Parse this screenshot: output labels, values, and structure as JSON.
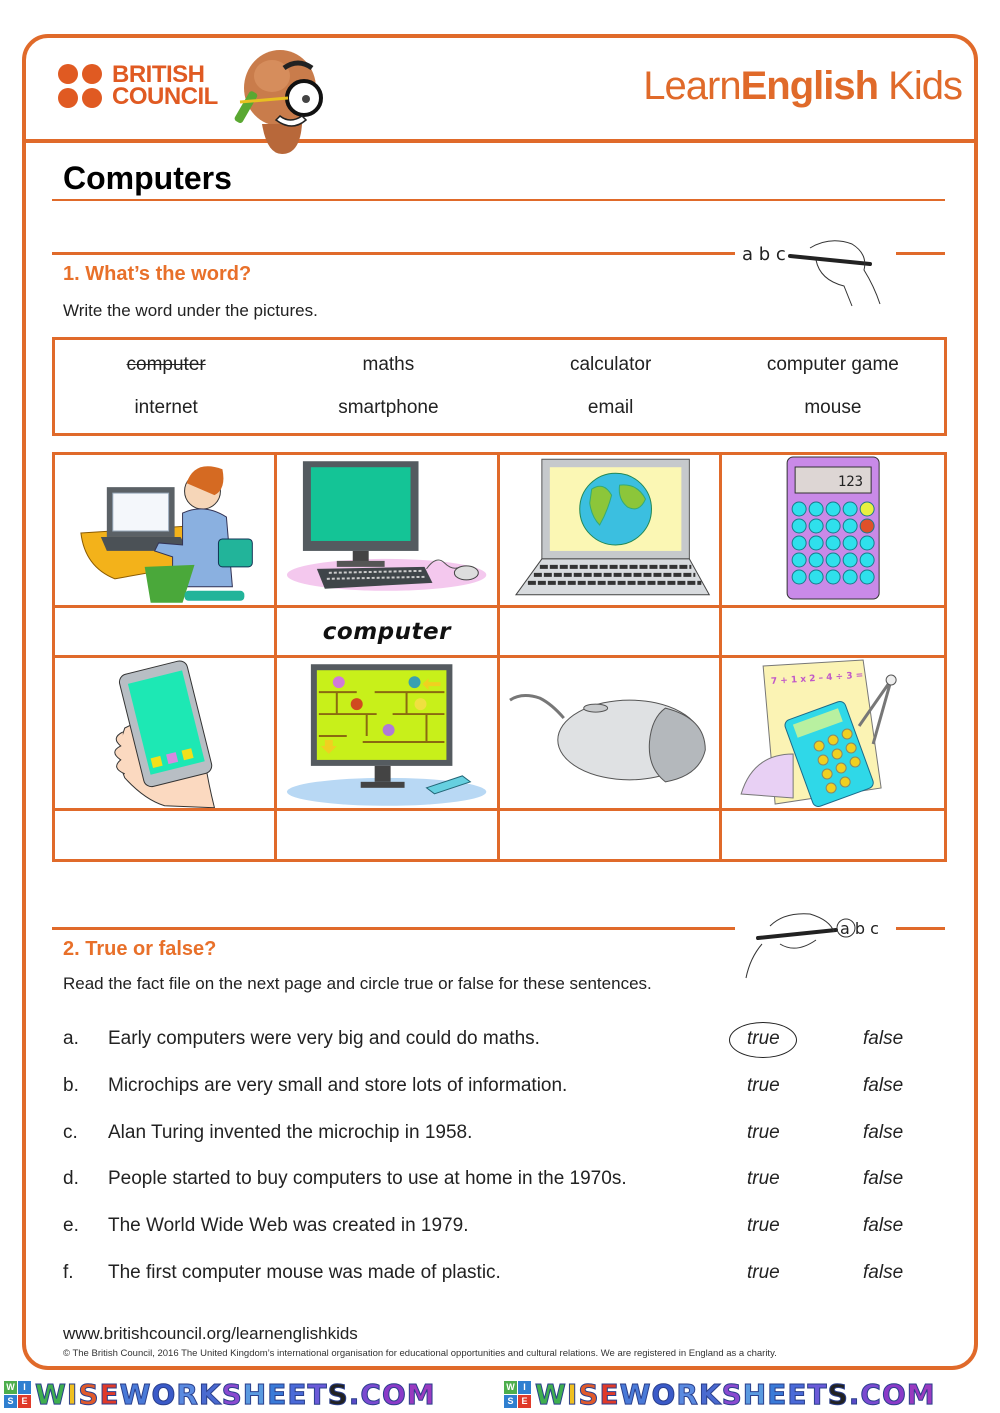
{
  "header": {
    "org_logo_line1": "BRITISH",
    "org_logo_line2": "COUNCIL",
    "brand_light": "Learn",
    "brand_bold": "English",
    "brand_tail": " Kids"
  },
  "page_title": "Computers",
  "section1": {
    "title": "1. What’s the word?",
    "instruction": "Write the word under the pictures.",
    "hand_icon_letters": "a b c",
    "word_bank": [
      {
        "word": "computer",
        "struck": true
      },
      {
        "word": "maths",
        "struck": false
      },
      {
        "word": "calculator",
        "struck": false
      },
      {
        "word": "computer game",
        "struck": false
      },
      {
        "word": "internet",
        "struck": false
      },
      {
        "word": "smartphone",
        "struck": false
      },
      {
        "word": "email",
        "struck": false
      },
      {
        "word": "mouse",
        "struck": false
      }
    ],
    "pictures_row1": [
      {
        "icon": "person-typing-on-laptop-icon",
        "answer": ""
      },
      {
        "icon": "desktop-computer-icon",
        "answer": "computer"
      },
      {
        "icon": "laptop-with-globe-icon",
        "answer": ""
      },
      {
        "icon": "calculator-icon",
        "answer": ""
      }
    ],
    "pictures_row2": [
      {
        "icon": "smartphone-in-hand-icon",
        "answer": ""
      },
      {
        "icon": "computer-game-monitor-icon",
        "answer": ""
      },
      {
        "icon": "computer-mouse-icon",
        "answer": ""
      },
      {
        "icon": "maths-equipment-icon",
        "answer": ""
      }
    ],
    "calculator_display": "123",
    "maths_equation": "7 + 1 x 2 – 4 ÷ 3 ="
  },
  "section2": {
    "title": "2. True or false?",
    "instruction": "Read the fact file on the next page and circle true or false for these sentences.",
    "hand_icon_letters": "a b c",
    "true_label": "true",
    "false_label": "false",
    "items": [
      {
        "letter": "a.",
        "text": "Early computers were very big and could do maths.",
        "circled": "true"
      },
      {
        "letter": "b.",
        "text": "Microchips are very small and store lots of information.",
        "circled": ""
      },
      {
        "letter": "c.",
        "text": "Alan Turing invented the microchip in 1958.",
        "circled": ""
      },
      {
        "letter": "d.",
        "text": "People started to buy computers to use at home in the 1970s.",
        "circled": ""
      },
      {
        "letter": "e.",
        "text": "The World Wide Web was created in 1979.",
        "circled": ""
      },
      {
        "letter": "f.",
        "text": "The first computer mouse was made of plastic.",
        "circled": ""
      }
    ]
  },
  "footer": {
    "url": "www.britishcouncil.org/learnenglishkids",
    "copyright": "© The British Council, 2016 The United Kingdom’s international organisation for educational opportunities and cultural relations. We are registered in England as a charity."
  },
  "watermark": {
    "badge_letters": [
      "W",
      "I",
      "S",
      "E"
    ],
    "text": "WISEWORKSHEETS.COM"
  },
  "colors": {
    "accent": "#e06a2a",
    "brand_orange": "#e05a22",
    "heading_orange": "#e8702a"
  }
}
